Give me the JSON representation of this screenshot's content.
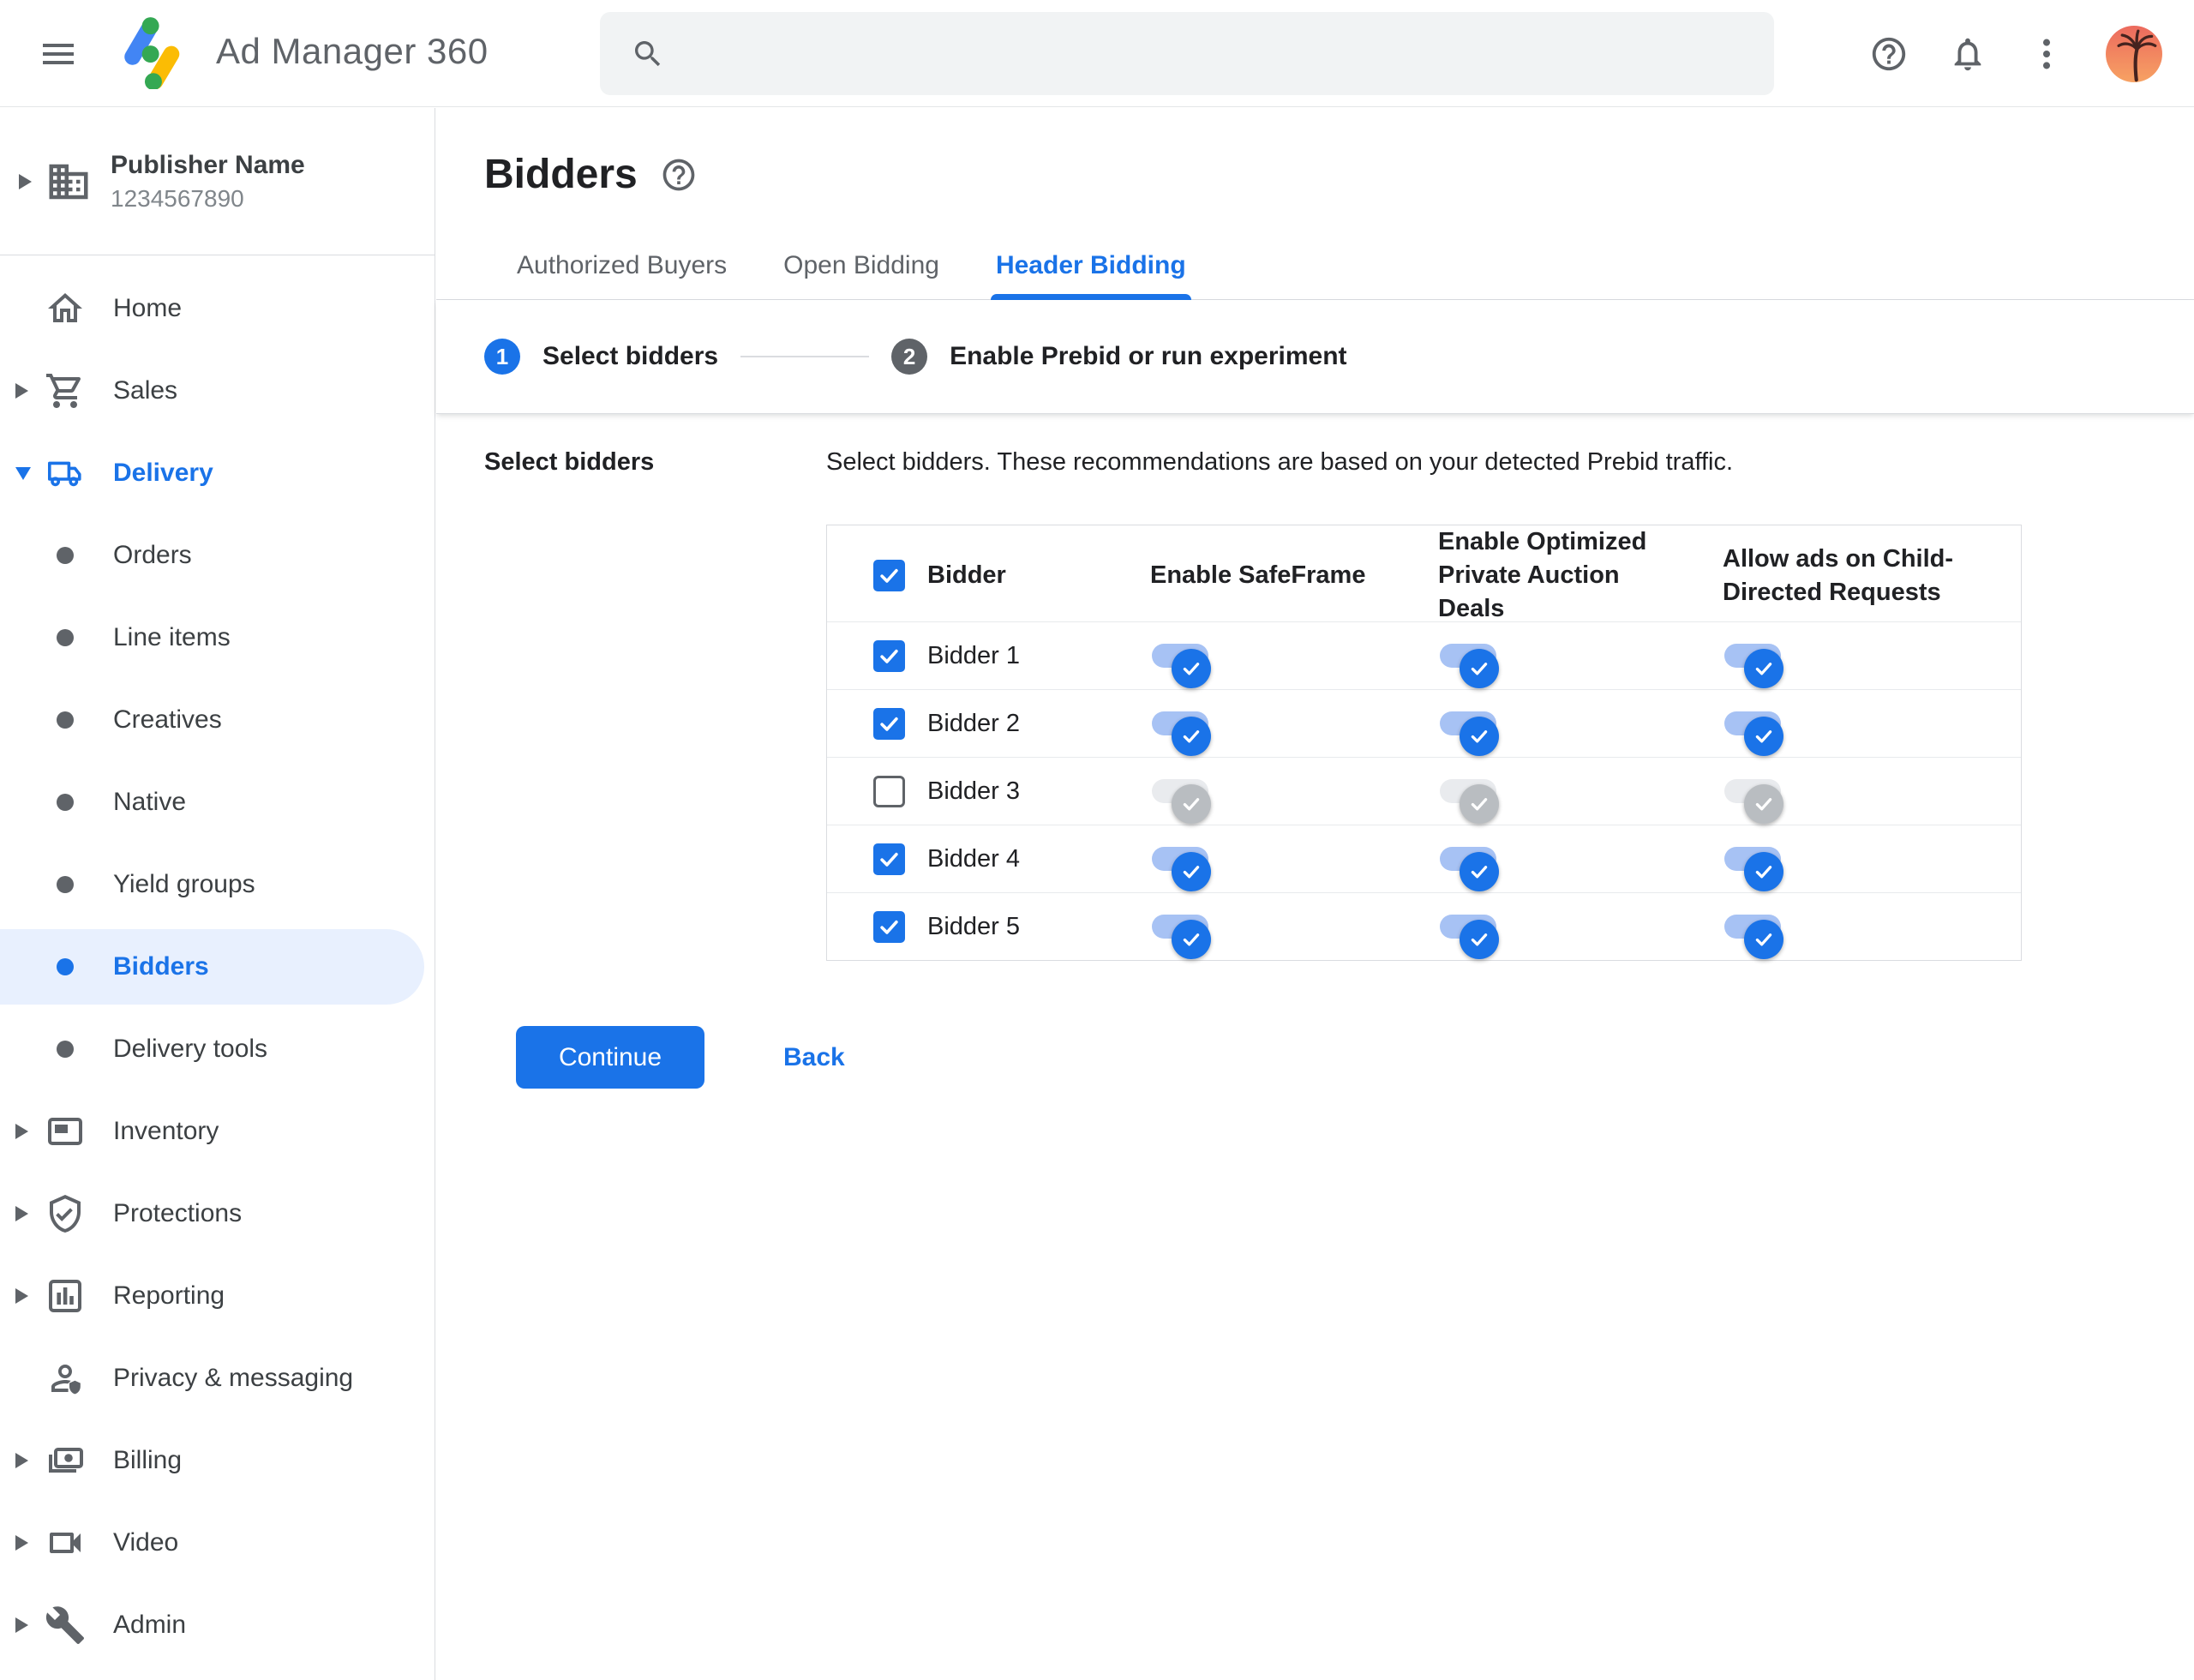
{
  "colors": {
    "accent": "#1a73e8",
    "toggle_track_on": "#a7c2f4",
    "selected_bg": "#e8f0fe",
    "text_primary": "#202124",
    "text_secondary": "#5f6368",
    "text_tertiary": "#80868b",
    "divider": "#dadce0",
    "row_divider": "#e8eaed",
    "search_bg": "#f1f3f4",
    "toggle_track_off": "#e9ebee",
    "toggle_thumb_off": "#b9bdc1",
    "toggle_check_off": "#d9dbde",
    "step_inactive": "#5f6368",
    "avatar_top": "#ec6a5e",
    "avatar_bottom": "#f7a263"
  },
  "topbar": {
    "app_title": "Ad Manager 360",
    "search_placeholder": ""
  },
  "sidebar": {
    "publisher": {
      "name": "Publisher Name",
      "id": "1234567890"
    },
    "items": [
      {
        "label": "Home",
        "active": false,
        "selected": false
      },
      {
        "label": "Sales",
        "active": false,
        "selected": false
      },
      {
        "label": "Delivery",
        "active": true,
        "selected": false
      },
      {
        "label": "Orders",
        "active": false,
        "selected": false
      },
      {
        "label": "Line items",
        "active": false,
        "selected": false
      },
      {
        "label": "Creatives",
        "active": false,
        "selected": false
      },
      {
        "label": "Native",
        "active": false,
        "selected": false
      },
      {
        "label": "Yield groups",
        "active": false,
        "selected": false
      },
      {
        "label": "Bidders",
        "active": true,
        "selected": true
      },
      {
        "label": "Delivery tools",
        "active": false,
        "selected": false
      },
      {
        "label": "Inventory",
        "active": false,
        "selected": false
      },
      {
        "label": "Protections",
        "active": false,
        "selected": false
      },
      {
        "label": "Reporting",
        "active": false,
        "selected": false
      },
      {
        "label": "Privacy & messaging",
        "active": false,
        "selected": false
      },
      {
        "label": "Billing",
        "active": false,
        "selected": false
      },
      {
        "label": "Video",
        "active": false,
        "selected": false
      },
      {
        "label": "Admin",
        "active": false,
        "selected": false
      }
    ]
  },
  "main": {
    "title": "Bidders",
    "tabs": [
      {
        "label": "Authorized Buyers",
        "active": false
      },
      {
        "label": "Open Bidding",
        "active": false
      },
      {
        "label": "Header Bidding",
        "active": true
      }
    ],
    "stepper": [
      {
        "number": "1",
        "label": "Select bidders",
        "active": true
      },
      {
        "number": "2",
        "label": "Enable Prebid or run experiment",
        "active": false
      }
    ],
    "section_label": "Select bidders",
    "description": "Select bidders. These recommendations are based on your detected Prebid traffic.",
    "table": {
      "header": {
        "select_all": true,
        "bidder": "Bidder",
        "safeframe": "Enable SafeFrame",
        "optimized": "Enable Optimized Private Auction Deals",
        "child_directed": "Allow ads on Child-Directed Requests"
      },
      "rows": [
        {
          "name": "Bidder 1",
          "checked": true,
          "safeframe": true,
          "optimized": true,
          "child_directed": true
        },
        {
          "name": "Bidder 2",
          "checked": true,
          "safeframe": true,
          "optimized": true,
          "child_directed": true
        },
        {
          "name": "Bidder 3",
          "checked": false,
          "safeframe": false,
          "optimized": false,
          "child_directed": false
        },
        {
          "name": "Bidder 4",
          "checked": true,
          "safeframe": true,
          "optimized": true,
          "child_directed": true
        },
        {
          "name": "Bidder 5",
          "checked": true,
          "safeframe": true,
          "optimized": true,
          "child_directed": true
        }
      ]
    },
    "actions": {
      "continue_label": "Continue",
      "back_label": "Back"
    }
  }
}
